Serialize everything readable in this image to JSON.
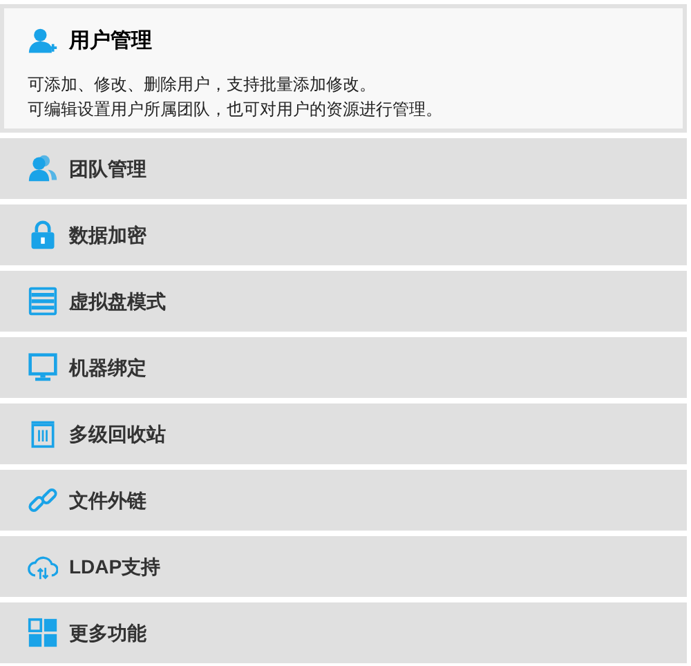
{
  "features": [
    {
      "label": "用户管理",
      "expanded": true,
      "description": [
        "可添加、修改、删除用户，支持批量添加修改。",
        "可编辑设置用户所属团队，也可对用户的资源进行管理。"
      ]
    },
    {
      "label": "团队管理",
      "expanded": false
    },
    {
      "label": "数据加密",
      "expanded": false
    },
    {
      "label": "虚拟盘模式",
      "expanded": false
    },
    {
      "label": "机器绑定",
      "expanded": false
    },
    {
      "label": "多级回收站",
      "expanded": false
    },
    {
      "label": "文件外链",
      "expanded": false
    },
    {
      "label": "LDAP支持",
      "expanded": false
    },
    {
      "label": "更多功能",
      "expanded": false
    }
  ]
}
